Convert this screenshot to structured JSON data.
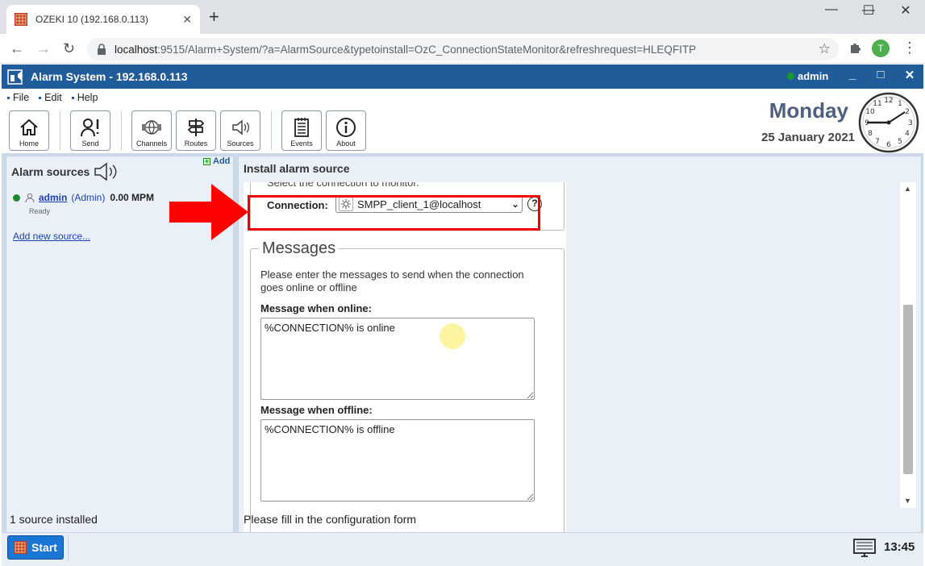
{
  "browser": {
    "tab_title": "OZEKI 10 (192.168.0.113)",
    "tab_close": "✕",
    "new_tab": "+",
    "url_host": "localhost",
    "url_rest": ":9515/Alarm+System/?a=AlarmSource&typetoinstall=OzC_ConnectionStateMonitor&refreshrequest=HLEQFITP",
    "profile_initial": "T",
    "controls": {
      "minimize": "—",
      "maximize": "☐",
      "close": "✕"
    }
  },
  "app": {
    "title": "Alarm System - 192.168.0.113",
    "user": "admin",
    "user_status_color": "#1a9a2a",
    "window_controls": {
      "minimize": "_",
      "maximize": "□",
      "close": "✕"
    }
  },
  "menu": {
    "items": [
      "File",
      "Edit",
      "Help"
    ]
  },
  "toolbar": {
    "buttons": [
      {
        "label": "Home",
        "icon": "home-icon"
      },
      {
        "label": "Send",
        "icon": "send-user-icon"
      },
      {
        "label": "Channels",
        "icon": "channels-icon"
      },
      {
        "label": "Routes",
        "icon": "routes-icon"
      },
      {
        "label": "Sources",
        "icon": "speaker-icon"
      },
      {
        "label": "Events",
        "icon": "events-icon"
      },
      {
        "label": "About",
        "icon": "info-icon"
      }
    ]
  },
  "datetime": {
    "day": "Monday",
    "date": "25 January 2021",
    "clock_time": "13:45"
  },
  "left_panel": {
    "title": "Alarm sources",
    "add_label": "Add",
    "source": {
      "name": "admin",
      "role": "(Admin)",
      "rate": "0.00 MPM",
      "status": "Ready"
    },
    "add_new_link": "Add new source...",
    "status_text": "1 source installed"
  },
  "main_panel": {
    "title": "Install alarm source",
    "select_hint": "Select the connection to monitor.",
    "connection_label": "Connection:",
    "connection_value": "SMPP_client_1@localhost",
    "help_label": "?",
    "messages_legend": "Messages",
    "messages_intro": "Please enter the messages to send when the connection goes online or offline",
    "online_label": "Message when online:",
    "online_value": "%CONNECTION% is online",
    "offline_label": "Message when offline:",
    "offline_value": "%CONNECTION% is offline",
    "status_text": "Please fill in the configuration form"
  },
  "taskbar": {
    "start_label": "Start",
    "time": "13:45"
  },
  "colors": {
    "accent": "#1f5c99",
    "annotation": "#e00000",
    "start_button": "#1976d2"
  }
}
